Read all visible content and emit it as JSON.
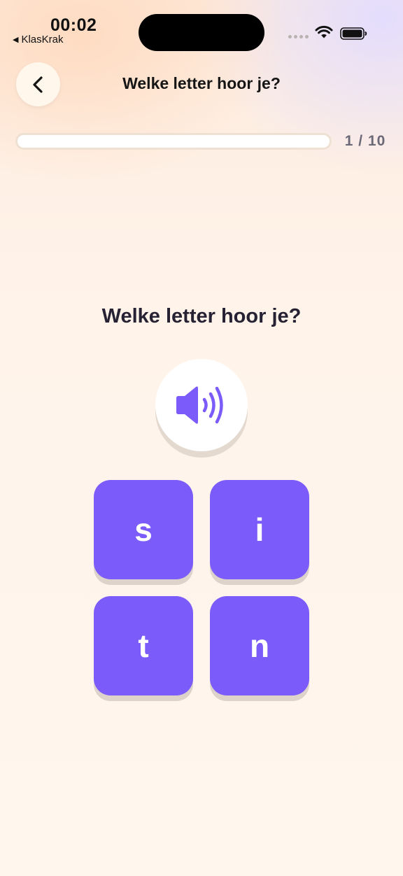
{
  "status_bar": {
    "time": "00:02",
    "back_app": "KlasKrak"
  },
  "header": {
    "title": "Welke letter hoor je?"
  },
  "progress": {
    "label": "1 / 10",
    "fraction": 0
  },
  "question": {
    "text": "Welke letter hoor je?",
    "audio_icon": "speaker-wave-icon"
  },
  "answers": [
    {
      "label": "s"
    },
    {
      "label": "i"
    },
    {
      "label": "t"
    },
    {
      "label": "n"
    }
  ],
  "colors": {
    "accent": "#7b5cfb",
    "tile_shadow": "#ddd3cb",
    "background": "#fff6ec",
    "title_text": "#272233",
    "progress_label": "#6b6878"
  }
}
